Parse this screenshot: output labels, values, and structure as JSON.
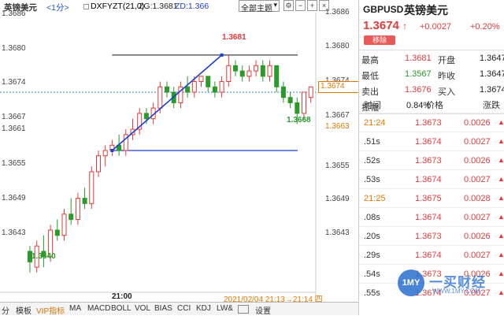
{
  "topbar": {
    "title": "英镑美元",
    "period": "<1分>",
    "indicator": "DXFYZT(21,0)",
    "zg": "ZG:1.3681",
    "zd": "ZD:1.366",
    "theme": "全部主题",
    "btn_settings": "⚙",
    "btn_minus": "−",
    "btn_plus": "+",
    "btn_close": "×"
  },
  "axis": {
    "right_ticks": [
      "1.3686",
      "1.3680",
      "1.3674",
      "1.3667",
      "1.3661",
      "1.3655",
      "1.3649",
      "1.3643"
    ],
    "left_ticks": [
      "1.3686",
      "1.3680",
      "1.3674",
      "1.3667",
      "1.3661",
      "1.3655",
      "1.3649",
      "1.3643"
    ],
    "current_tag": "1.3674",
    "orange_tag": "1.3663",
    "x_label": "21:00",
    "time_range": "2021/02/04 21:13→21:14 四"
  },
  "annotations": {
    "high_label": "1.3681",
    "low_label": "1.3640",
    "recent_low_label": "1.3668"
  },
  "chart_data": {
    "type": "candlestick",
    "ylim": [
      1.3637,
      1.3689
    ],
    "candles": [
      {
        "o": 1.3644,
        "c": 1.3642,
        "h": 1.3645,
        "l": 1.364
      },
      {
        "o": 1.3641,
        "c": 1.3645,
        "h": 1.3646,
        "l": 1.364
      },
      {
        "o": 1.3644,
        "c": 1.3643,
        "h": 1.3647,
        "l": 1.3641
      },
      {
        "o": 1.3643,
        "c": 1.3648,
        "h": 1.3649,
        "l": 1.3642
      },
      {
        "o": 1.3648,
        "c": 1.3647,
        "h": 1.365,
        "l": 1.3646
      },
      {
        "o": 1.3647,
        "c": 1.3651,
        "h": 1.3652,
        "l": 1.3646
      },
      {
        "o": 1.3651,
        "c": 1.365,
        "h": 1.3654,
        "l": 1.3649
      },
      {
        "o": 1.365,
        "c": 1.3654,
        "h": 1.3655,
        "l": 1.3649
      },
      {
        "o": 1.3654,
        "c": 1.3653,
        "h": 1.3656,
        "l": 1.3652
      },
      {
        "o": 1.3653,
        "c": 1.3659,
        "h": 1.366,
        "l": 1.3652
      },
      {
        "o": 1.3659,
        "c": 1.3662,
        "h": 1.3663,
        "l": 1.3658
      },
      {
        "o": 1.3662,
        "c": 1.3663,
        "h": 1.3664,
        "l": 1.366
      },
      {
        "o": 1.3663,
        "c": 1.3664,
        "h": 1.3665,
        "l": 1.3662
      },
      {
        "o": 1.3664,
        "c": 1.3663,
        "h": 1.3666,
        "l": 1.3662
      },
      {
        "o": 1.3663,
        "c": 1.3666,
        "h": 1.3667,
        "l": 1.3662
      },
      {
        "o": 1.3666,
        "c": 1.3667,
        "h": 1.3669,
        "l": 1.3665
      },
      {
        "o": 1.3667,
        "c": 1.367,
        "h": 1.3671,
        "l": 1.3666
      },
      {
        "o": 1.367,
        "c": 1.3669,
        "h": 1.3671,
        "l": 1.3668
      },
      {
        "o": 1.3669,
        "c": 1.3671,
        "h": 1.3672,
        "l": 1.3668
      },
      {
        "o": 1.3671,
        "c": 1.3675,
        "h": 1.3676,
        "l": 1.367
      },
      {
        "o": 1.3675,
        "c": 1.3674,
        "h": 1.3676,
        "l": 1.3673
      },
      {
        "o": 1.3674,
        "c": 1.3672,
        "h": 1.3675,
        "l": 1.3671
      },
      {
        "o": 1.3672,
        "c": 1.3675,
        "h": 1.3676,
        "l": 1.3671
      },
      {
        "o": 1.3675,
        "c": 1.3674,
        "h": 1.3677,
        "l": 1.3673
      },
      {
        "o": 1.3674,
        "c": 1.3676,
        "h": 1.3677,
        "l": 1.3673
      },
      {
        "o": 1.3676,
        "c": 1.3677,
        "h": 1.3677,
        "l": 1.3675
      },
      {
        "o": 1.3677,
        "c": 1.3675,
        "h": 1.3677,
        "l": 1.3674
      },
      {
        "o": 1.3675,
        "c": 1.3674,
        "h": 1.3676,
        "l": 1.3673
      },
      {
        "o": 1.3674,
        "c": 1.3676,
        "h": 1.3677,
        "l": 1.3673
      },
      {
        "o": 1.3676,
        "c": 1.3679,
        "h": 1.3681,
        "l": 1.3675
      },
      {
        "o": 1.3679,
        "c": 1.3678,
        "h": 1.368,
        "l": 1.3677
      },
      {
        "o": 1.3678,
        "c": 1.3677,
        "h": 1.3679,
        "l": 1.3676
      },
      {
        "o": 1.3677,
        "c": 1.3678,
        "h": 1.3679,
        "l": 1.3676
      },
      {
        "o": 1.3678,
        "c": 1.3679,
        "h": 1.368,
        "l": 1.3677
      },
      {
        "o": 1.3679,
        "c": 1.3677,
        "h": 1.368,
        "l": 1.3676
      },
      {
        "o": 1.3677,
        "c": 1.3679,
        "h": 1.368,
        "l": 1.3676
      },
      {
        "o": 1.3679,
        "c": 1.3675,
        "h": 1.3679,
        "l": 1.3674
      },
      {
        "o": 1.3675,
        "c": 1.3673,
        "h": 1.3676,
        "l": 1.3672
      },
      {
        "o": 1.3673,
        "c": 1.3672,
        "h": 1.3674,
        "l": 1.3671
      },
      {
        "o": 1.3672,
        "c": 1.367,
        "h": 1.3673,
        "l": 1.3668
      },
      {
        "o": 1.367,
        "c": 1.3674,
        "h": 1.3674,
        "l": 1.3669
      },
      {
        "o": 1.3673,
        "c": 1.3675,
        "h": 1.3675,
        "l": 1.3672
      }
    ],
    "trend_line": {
      "from_index": 12,
      "from": 1.3663,
      "to_index": 28,
      "to": 1.3681
    },
    "high_line": 1.3681,
    "low_line": 1.3663,
    "current_line": 1.3674
  },
  "bottom": {
    "items": [
      "分",
      "模板",
      "VIP指标",
      "MA",
      "MACD",
      "BOLL",
      "VOL",
      "BIAS",
      "CCI",
      "KDJ",
      "LW&",
      "",
      "设置"
    ]
  },
  "quote": {
    "code": "GBPUSD",
    "name": "英镑美元",
    "price": "1.3674",
    "price_arrow": "↑",
    "change": "+0.0027",
    "pct": "+0.20%",
    "tag": "移除",
    "stats": [
      {
        "l1": "最高",
        "v1": "1.3681",
        "l2": "开盘",
        "v2": "1.3647"
      },
      {
        "l1": "最低",
        "v1": "1.3567",
        "l2": "昨收",
        "v2": "1.3647"
      },
      {
        "l1": "卖出",
        "v1": "1.3676",
        "l2": "买入",
        "v2": "1.3674"
      },
      {
        "l1": "振幅",
        "v1": "0.84%",
        "l2": "",
        "v2": ""
      }
    ],
    "headers": [
      "时间",
      "价格",
      "涨跌"
    ],
    "trades": [
      {
        "t": "21:24",
        "p": "1.3673",
        "c": "0.0026"
      },
      {
        "t": ".51s",
        "p": "1.3674",
        "c": "0.0027"
      },
      {
        "t": ".52s",
        "p": "1.3673",
        "c": "0.0026"
      },
      {
        "t": ".53s",
        "p": "1.3674",
        "c": "0.0027"
      },
      {
        "t": "21:25",
        "p": "1.3675",
        "c": "0.0028"
      },
      {
        "t": ".08s",
        "p": "1.3674",
        "c": "0.0027"
      },
      {
        "t": ".20s",
        "p": "1.3673",
        "c": "0.0026"
      },
      {
        "t": ".29s",
        "p": "1.3674",
        "c": "0.0027"
      },
      {
        "t": ".54s",
        "p": "1.3673",
        "c": "0.0026"
      },
      {
        "t": ".55s",
        "p": "1.3674",
        "c": "0.0027"
      }
    ]
  },
  "watermark": {
    "logo": "1MY",
    "text": "一买财经",
    "url": "WWW.1MY.COM"
  }
}
